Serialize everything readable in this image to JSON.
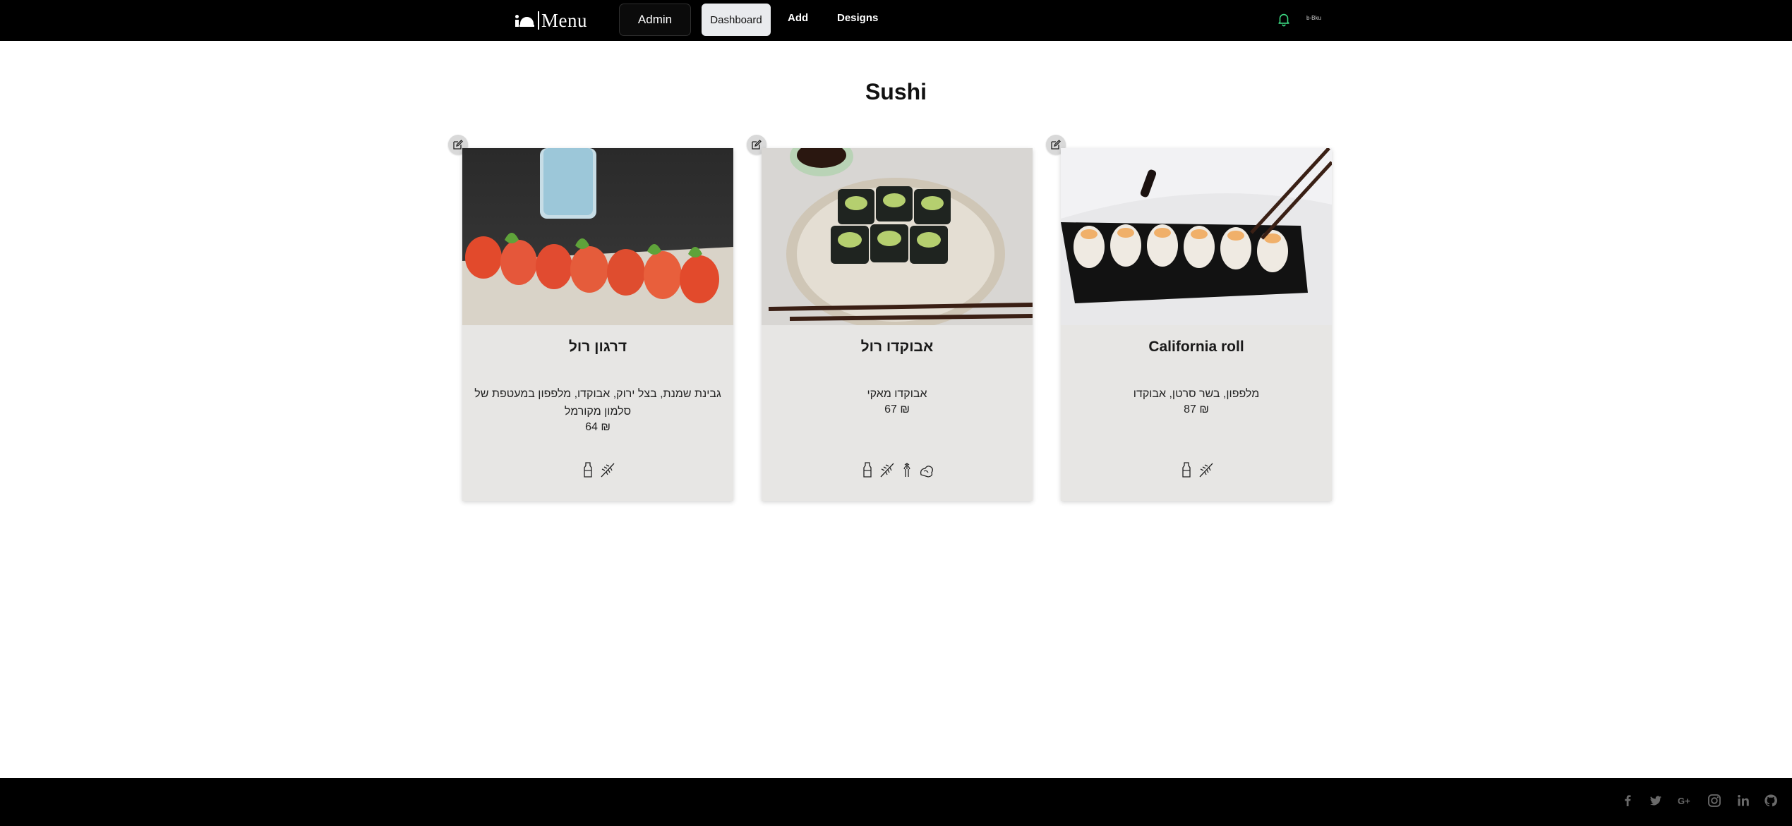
{
  "header": {
    "logo_text": "Menu",
    "nav": {
      "admin": "Admin",
      "dashboard": "Dashboard",
      "add": "Add",
      "designs": "Designs"
    },
    "user_label": "b-Bku",
    "bell_color": "#3ddc84"
  },
  "page": {
    "title": "Sushi"
  },
  "cards": [
    {
      "name": "דרגון רול",
      "description": "גבינת שמנת, בצל ירוק, אבוקדו, מלפפון במעטפת של סלמון מקורמל",
      "price": "64 ₪",
      "allergens": [
        "milk-icon",
        "wheat-icon"
      ],
      "image": "salmon-dragon-roll"
    },
    {
      "name": "אבוקדו רול",
      "description": "אבוקדו מאקי",
      "price": "67 ₪",
      "allergens": [
        "milk-icon",
        "wheat-icon",
        "celery-icon",
        "egg-icon"
      ],
      "image": "avocado-maki"
    },
    {
      "name": "California roll",
      "description": "מלפפון, בשר סרטן, אבוקדו",
      "price": "87 ₪",
      "allergens": [
        "milk-icon",
        "wheat-icon"
      ],
      "image": "california-roll"
    }
  ],
  "footer": {
    "social_icons": [
      "facebook-icon",
      "twitter-icon",
      "google-plus-icon",
      "instagram-icon",
      "linkedin-icon",
      "github-icon"
    ],
    "icon_color": "#6a6a6a"
  },
  "colors": {
    "topbar": "#000000",
    "card_bg": "#e7e6e4",
    "dashboard_active": "#e9ebee"
  }
}
